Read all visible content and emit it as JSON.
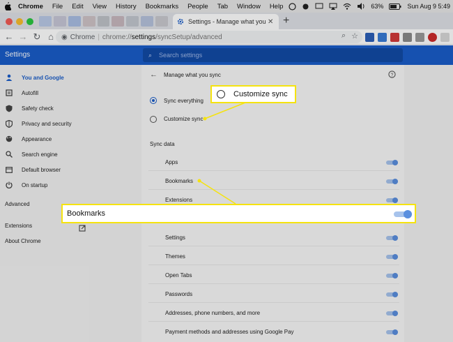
{
  "menubar": {
    "items": [
      "Chrome",
      "File",
      "Edit",
      "View",
      "History",
      "Bookmarks",
      "People",
      "Tab",
      "Window",
      "Help"
    ],
    "battery": "63%",
    "datetime": "Sun Aug 9  5:49"
  },
  "tab": {
    "title": "Settings - Manage what you s",
    "new_tab": "+"
  },
  "toolbar": {
    "site_label": "Chrome",
    "url_prefix": "chrome://",
    "url_main": "settings",
    "url_suffix": "/syncSetup/advanced"
  },
  "header": {
    "title": "Settings",
    "search_placeholder": "Search settings"
  },
  "sidebar": {
    "items": [
      {
        "label": "You and Google",
        "icon": "person-icon"
      },
      {
        "label": "Autofill",
        "icon": "autofill-icon"
      },
      {
        "label": "Safety check",
        "icon": "shield-check-icon"
      },
      {
        "label": "Privacy and security",
        "icon": "shield-icon"
      },
      {
        "label": "Appearance",
        "icon": "palette-icon"
      },
      {
        "label": "Search engine",
        "icon": "search-icon"
      },
      {
        "label": "Default browser",
        "icon": "browser-icon"
      },
      {
        "label": "On startup",
        "icon": "power-icon"
      }
    ],
    "advanced": "Advanced",
    "extensions": "Extensions",
    "about": "About Chrome"
  },
  "content": {
    "page_title": "Manage what you sync",
    "sync_everything": "Sync everything",
    "customize_sync": "Customize sync",
    "sync_data_heading": "Sync data",
    "toggles_top": [
      "Apps",
      "Bookmarks",
      "Extensions"
    ],
    "toggles_bottom": [
      "Settings",
      "Themes",
      "Open Tabs",
      "Passwords",
      "Addresses, phone numbers, and more",
      "Payment methods and addresses using Google Pay"
    ]
  },
  "callouts": {
    "customize_sync": "Customize sync",
    "bookmarks": "Bookmarks"
  },
  "colors": {
    "accent": "#1a5dc9",
    "callout_border": "#f5e30f",
    "toggle_knob": "#5a8fdf"
  }
}
